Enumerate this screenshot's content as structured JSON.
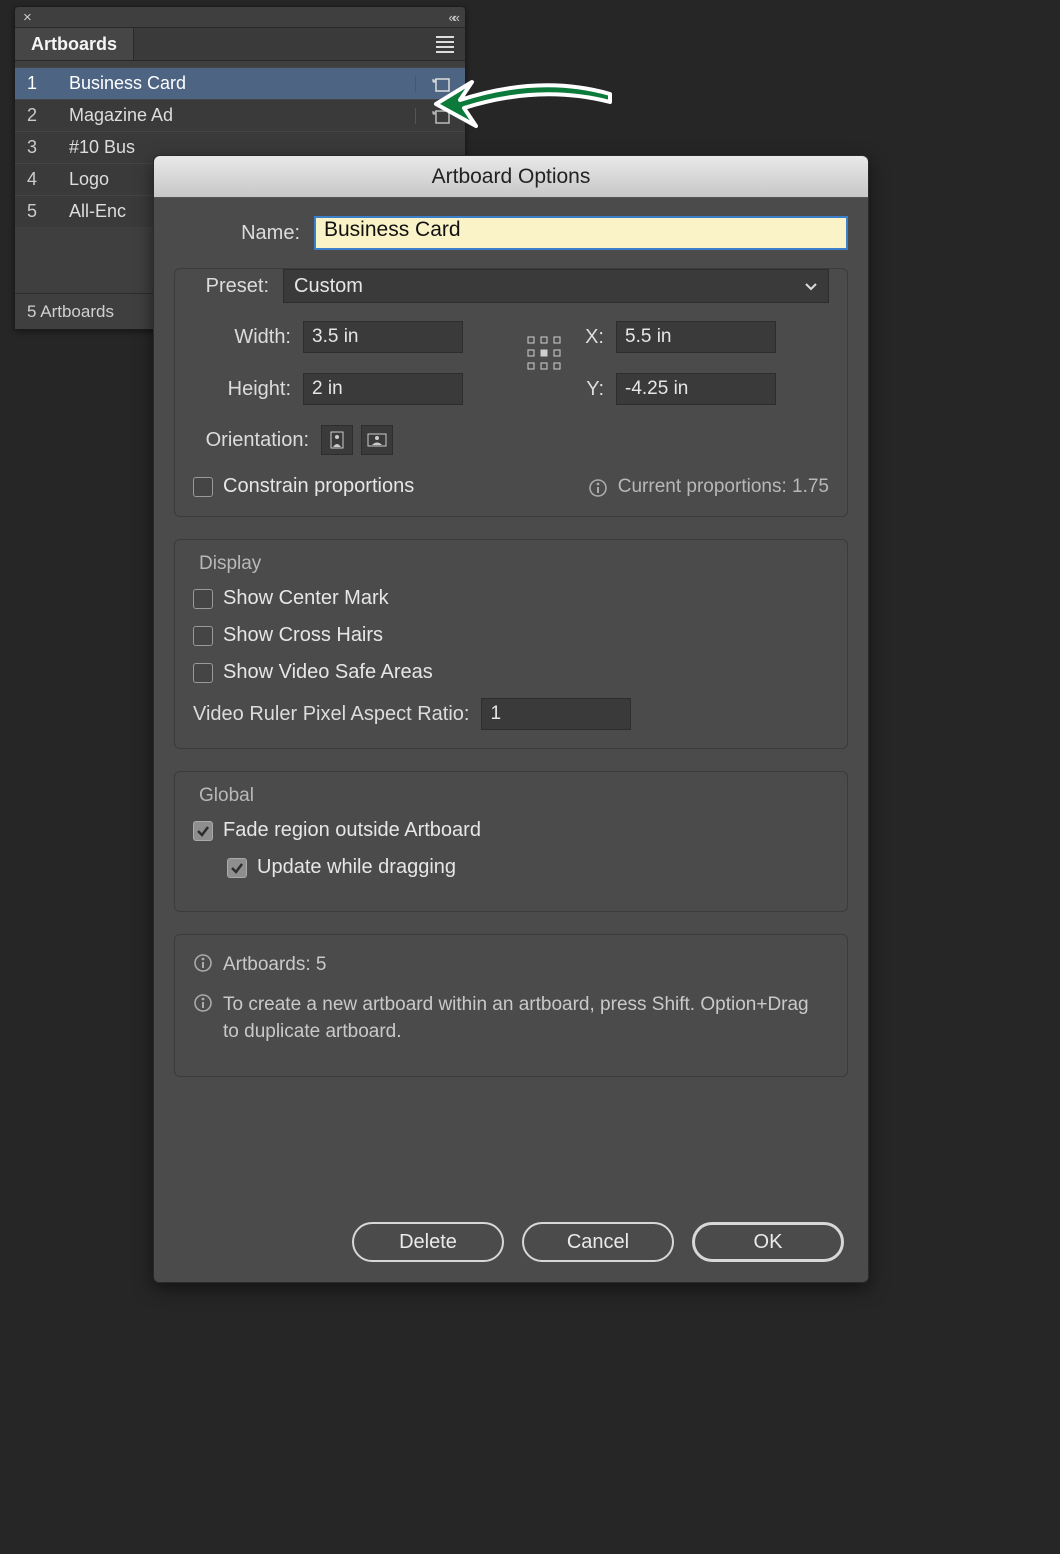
{
  "panel": {
    "title": "Artboards",
    "footer": "5 Artboards",
    "rows": [
      {
        "num": "1",
        "name": "Business Card"
      },
      {
        "num": "2",
        "name": "Magazine Ad"
      },
      {
        "num": "3",
        "name": "#10 Bus"
      },
      {
        "num": "4",
        "name": "Logo"
      },
      {
        "num": "5",
        "name": "All-Enc"
      }
    ]
  },
  "dialog": {
    "title": "Artboard Options",
    "name_label": "Name:",
    "name_value": "Business Card",
    "preset_label": "Preset:",
    "preset_value": "Custom",
    "width_label": "Width:",
    "width_value": "3.5 in",
    "height_label": "Height:",
    "height_value": "2 in",
    "x_label": "X:",
    "x_value": "5.5 in",
    "y_label": "Y:",
    "y_value": "-4.25 in",
    "orientation_label": "Orientation:",
    "constrain_label": "Constrain proportions",
    "proportions_text": "Current proportions: 1.75",
    "display_legend": "Display",
    "show_center": "Show Center Mark",
    "show_cross": "Show Cross Hairs",
    "show_safe": "Show Video Safe Areas",
    "video_ruler_label": "Video Ruler Pixel Aspect Ratio:",
    "video_ruler_value": "1",
    "global_legend": "Global",
    "fade_label": "Fade region outside Artboard",
    "update_label": "Update while dragging",
    "artboards_count": "Artboards: 5",
    "hint": "To create a new artboard within an artboard, press Shift. Option+Drag to duplicate artboard.",
    "delete": "Delete",
    "cancel": "Cancel",
    "ok": "OK"
  }
}
